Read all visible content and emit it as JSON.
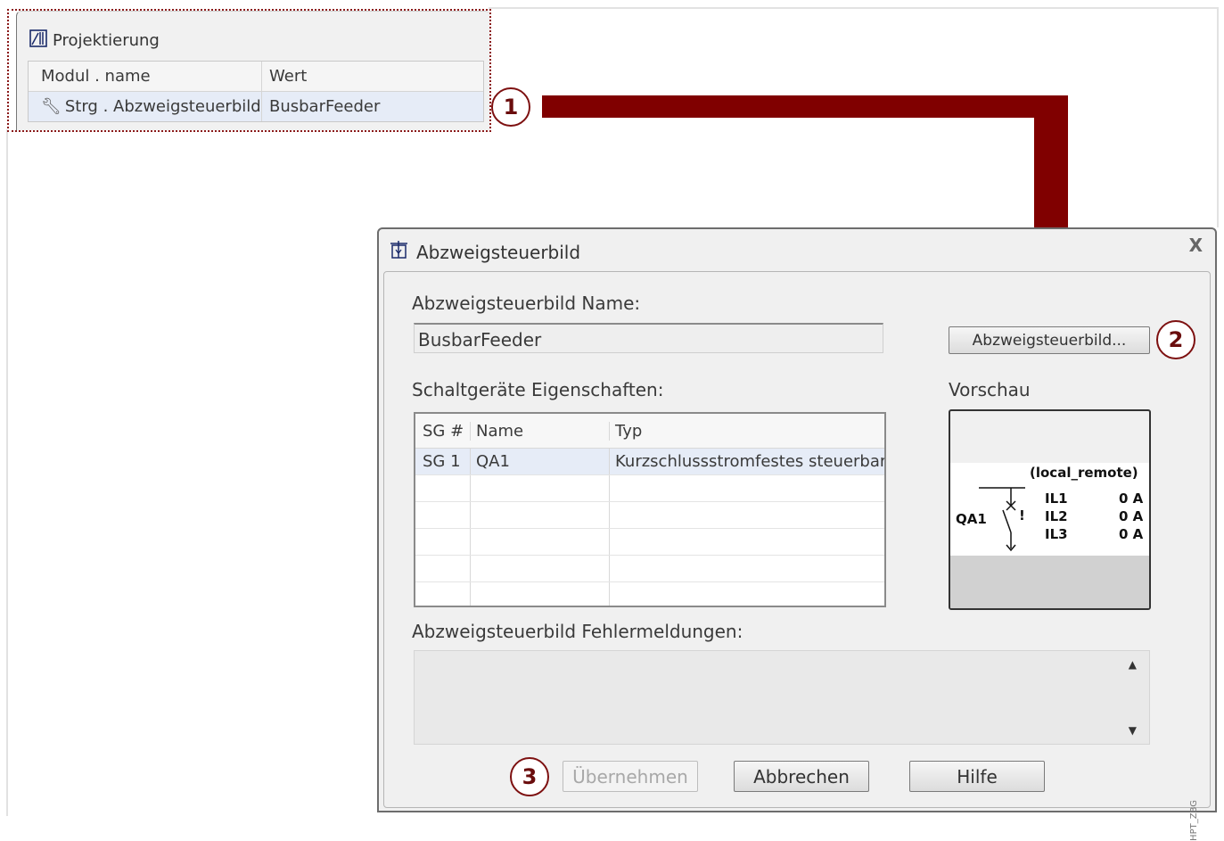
{
  "projektierung": {
    "title": "Projektierung",
    "columns": [
      "Modul . name",
      "Wert"
    ],
    "rows": [
      {
        "name": "Strg . Abzweigsteuerbild",
        "value": "BusbarFeeder"
      }
    ]
  },
  "markers": [
    "1",
    "2",
    "3"
  ],
  "dialog": {
    "title": "Abzweigsteuerbild",
    "close": "X",
    "name_label": "Abzweigsteuerbild Name:",
    "name_value": "BusbarFeeder",
    "browse_button": "Abzweigsteuerbild...",
    "props_label": "Schaltgeräte Eigenschaften:",
    "preview_label": "Vorschau",
    "table": {
      "columns": [
        "SG #",
        "Name",
        "Typ"
      ],
      "rows": [
        {
          "sg": "SG 1",
          "name": "QA1",
          "typ": "Kurzschlussstromfestes steuerbar"
        }
      ]
    },
    "errors_label": "Abzweigsteuerbild Fehlermeldungen:",
    "buttons": {
      "apply": "Übernehmen",
      "cancel": "Abbrechen",
      "help": "Hilfe"
    },
    "watermark": "HPT_ZBG"
  },
  "preview": {
    "mode": "(local_remote)",
    "device": "QA1",
    "mark": "!",
    "phases": [
      {
        "name": "IL1",
        "value": "0 A"
      },
      {
        "name": "IL2",
        "value": "0 A"
      },
      {
        "name": "IL3",
        "value": "0 A"
      }
    ]
  },
  "colors": {
    "accent": "#800000",
    "selection": "#e6ecf7"
  },
  "icons": [
    "projektierung-icon",
    "wrench-icon",
    "feeder-icon",
    "scroll-up-icon",
    "scroll-down-icon"
  ]
}
